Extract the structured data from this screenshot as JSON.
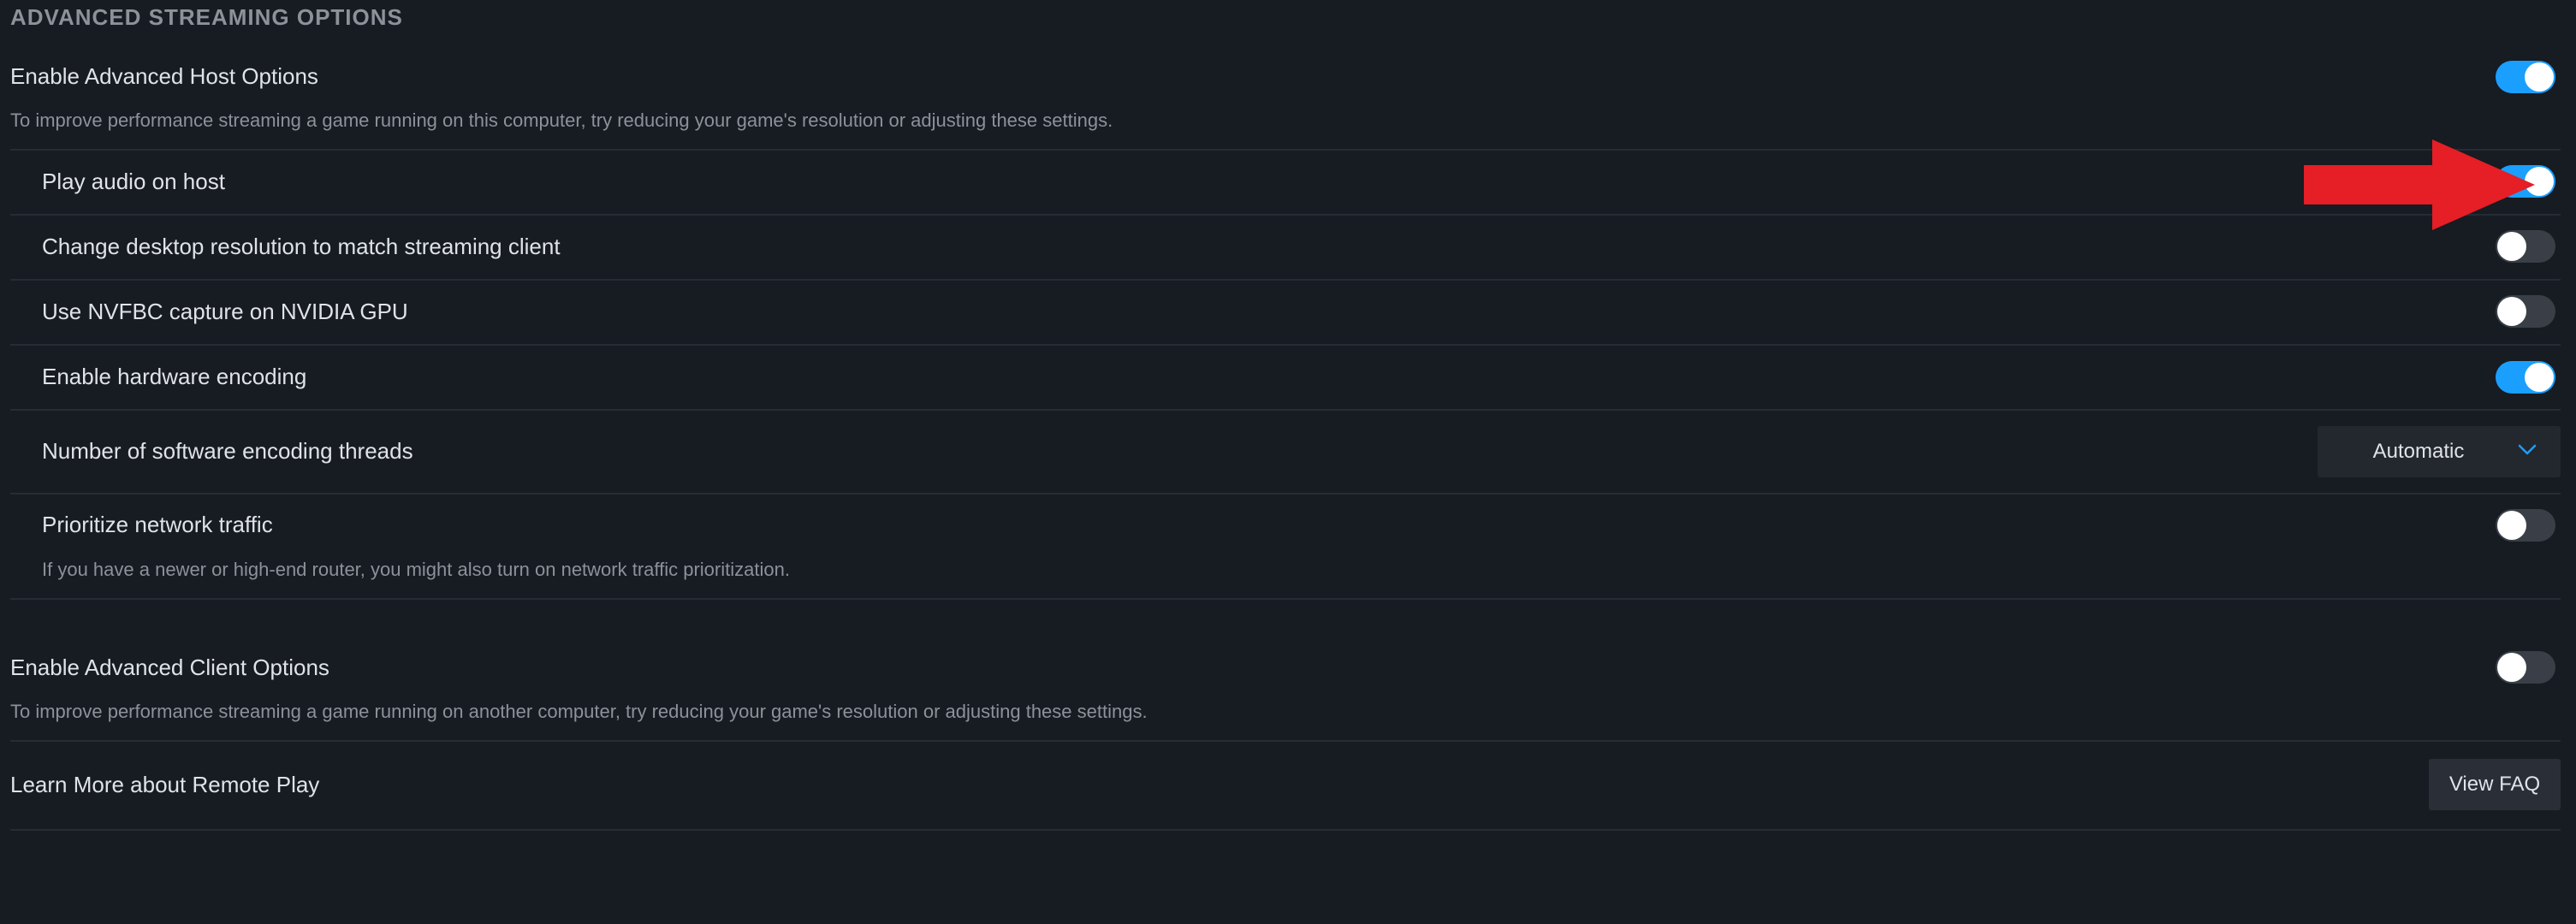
{
  "section": {
    "title": "ADVANCED STREAMING OPTIONS"
  },
  "host": {
    "label": "Enable Advanced Host Options",
    "description": "To improve performance streaming a game running on this computer, try reducing your game's resolution or adjusting these settings.",
    "enabled": true
  },
  "options": [
    {
      "label": "Play audio on host",
      "enabled": true
    },
    {
      "label": "Change desktop resolution to match streaming client",
      "enabled": false
    },
    {
      "label": "Use NVFBC capture on NVIDIA GPU",
      "enabled": false
    },
    {
      "label": "Enable hardware encoding",
      "enabled": true
    }
  ],
  "threads": {
    "label": "Number of software encoding threads",
    "selected": "Automatic"
  },
  "network": {
    "label": "Prioritize network traffic",
    "description": "If you have a newer or high-end router, you might also turn on network traffic prioritization.",
    "enabled": false
  },
  "client": {
    "label": "Enable Advanced Client Options",
    "description": "To improve performance streaming a game running on another computer, try reducing your game's resolution or adjusting these settings.",
    "enabled": false
  },
  "learn_more": {
    "label": "Learn More about Remote Play",
    "button": "View FAQ"
  },
  "colors": {
    "background": "#171b22",
    "toggle_on": "#1a9fff",
    "toggle_off": "#3a3f47",
    "annotation_arrow": "#e61e25"
  },
  "icons": {
    "dropdown": "chevron-down-icon",
    "annotation": "red-arrow-icon"
  }
}
